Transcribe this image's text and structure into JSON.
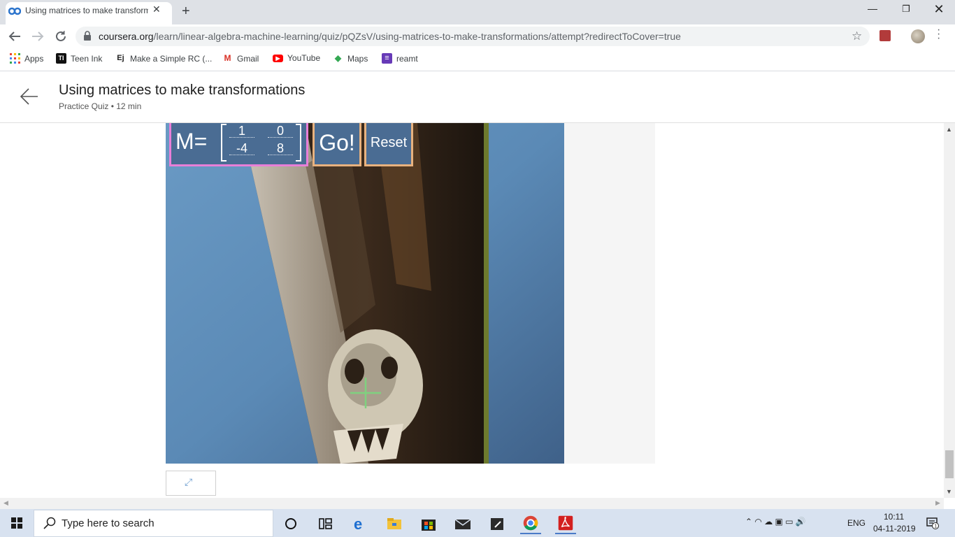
{
  "browser": {
    "tab_title": "Using matrices to make transform",
    "tab_close": "✕",
    "new_tab": "+",
    "url_host": "coursera.org",
    "url_path": "/learn/linear-algebra-machine-learning/quiz/pQZsV/using-matrices-to-make-transformations/attempt?redirectToCover=true",
    "window_controls": {
      "minimize": "—",
      "maximize": "❐",
      "close": "✕"
    }
  },
  "bookmarks": [
    {
      "label": "Apps",
      "icon": "apps-grid-icon",
      "color": "#ea4335"
    },
    {
      "label": "Teen Ink",
      "icon": "teen-ink-icon",
      "color": "#111111",
      "badge": "TI"
    },
    {
      "label": "Make a Simple RC (...",
      "icon": "ej-icon",
      "color": "#ffffff",
      "badge": "Ej"
    },
    {
      "label": "Gmail",
      "icon": "gmail-icon",
      "color": "#d93025",
      "badge": "M"
    },
    {
      "label": "YouTube",
      "icon": "youtube-icon",
      "color": "#ff0000",
      "badge": "▶"
    },
    {
      "label": "Maps",
      "icon": "maps-icon",
      "color": "#34a853",
      "badge": "◆"
    },
    {
      "label": "reamt",
      "icon": "reamt-icon",
      "color": "#673ab7",
      "badge": "≡"
    }
  ],
  "header": {
    "title": "Using matrices to make transformations",
    "subtitle": "Practice Quiz • 12 min"
  },
  "widget": {
    "matrix_label": "M=",
    "matrix": {
      "a": "1",
      "b": "0",
      "c": "-4",
      "d": "8"
    },
    "go_label": "Go!",
    "reset_label": "Reset",
    "expand_icon": "⤢"
  },
  "taskbar": {
    "search_placeholder": "Type here to search",
    "tray_icons": "⌃  ◠  ☁  ▣  ▭  🔊",
    "language": "ENG",
    "time": "10:11",
    "date": "04-11-2019",
    "notification_count": "1"
  },
  "colors": {
    "widget_blue": "#4a6c93",
    "matrix_border": "#e87fd8",
    "button_border": "#e8b27f",
    "crosshair": "#7fd17f"
  }
}
